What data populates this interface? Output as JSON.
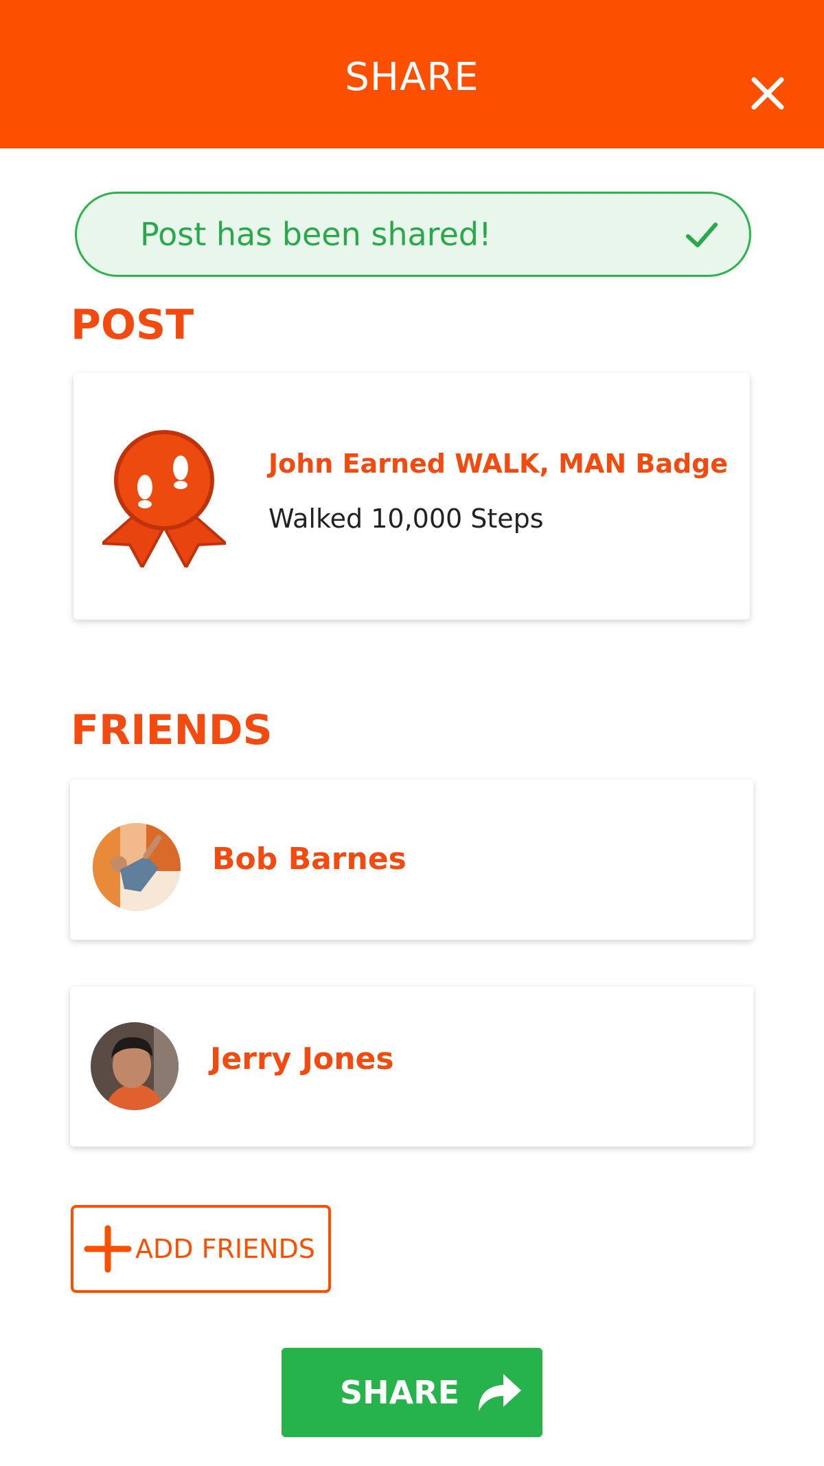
{
  "header": {
    "title": "SHARE",
    "close_icon": "close-icon"
  },
  "toast": {
    "message": "Post has been shared!",
    "icon": "check-icon",
    "color": "#2aa84a"
  },
  "post": {
    "section_title": "POST",
    "heading": "John Earned WALK, MAN Badge",
    "subtitle": "Walked 10,000 Steps",
    "icon": "badge-footprints-icon"
  },
  "friends": {
    "section_title": "FRIENDS",
    "items": [
      {
        "name": "Bob Barnes"
      },
      {
        "name": "Jerry Jones"
      }
    ]
  },
  "add_friends": {
    "label": "ADD FRIENDS",
    "icon": "plus-icon"
  },
  "share_button": {
    "label": "SHARE",
    "icon": "share-arrow-icon"
  },
  "colors": {
    "brand": "#fd4f00",
    "accent_text": "#f24a0f",
    "success": "#27b34c"
  }
}
